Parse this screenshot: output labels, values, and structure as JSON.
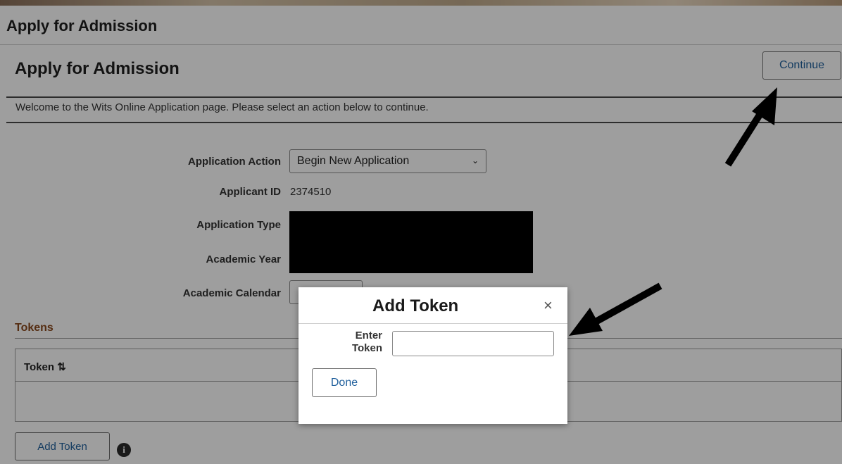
{
  "window": {
    "title": "Apply for Admission"
  },
  "page": {
    "heading": "Apply for Admission",
    "continue_label": "Continue",
    "welcome_text": "Welcome to the Wits Online Application page. Please select an action below to continue."
  },
  "form": {
    "application_action_label": "Application Action",
    "application_action_value": "Begin New Application",
    "applicant_id_label": "Applicant ID",
    "applicant_id_value": "2374510",
    "application_type_label": "Application Type",
    "academic_year_label": "Academic Year",
    "academic_calendar_label": "Academic Calendar"
  },
  "tokens": {
    "heading": "Tokens",
    "column_header": "Token ⇅",
    "add_button_label": "Add Token"
  },
  "modal": {
    "title": "Add Token",
    "close_glyph": "×",
    "enter_token_label_line1": "Enter",
    "enter_token_label_line2": "Token",
    "token_value": "",
    "done_label": "Done"
  },
  "icons": {
    "info": "info-icon",
    "close": "close-icon",
    "chevron": "chevron-down-icon",
    "sort": "sort-icon"
  },
  "colors": {
    "accent_link": "#1f5f9c",
    "section_heading": "#8a4a1e",
    "annotation_arrow": "#000000"
  }
}
